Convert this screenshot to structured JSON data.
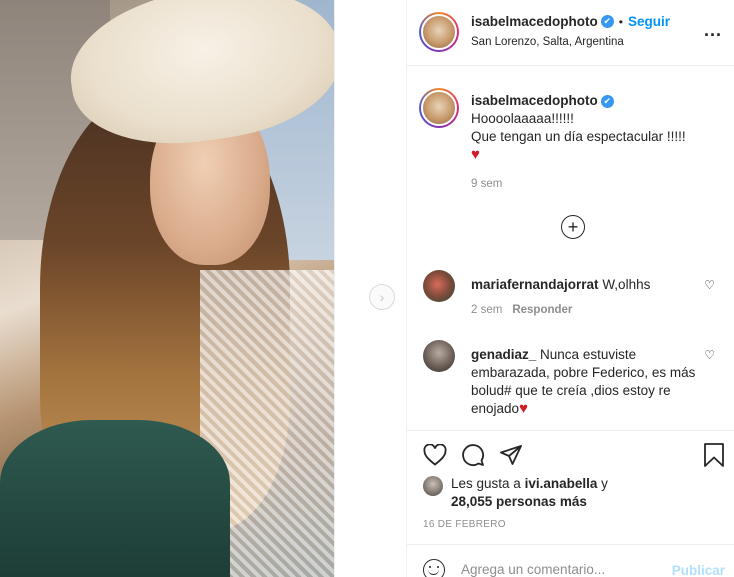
{
  "post": {
    "username": "isabelmacedophoto",
    "verified_glyph": "✔",
    "dot": "•",
    "follow_label": "Seguir",
    "location": "San Lorenzo, Salta, Argentina",
    "more_icon": "...",
    "next_icon": "›",
    "photo_alt": "Selfie photo of woman in straw hat"
  },
  "caption": {
    "username": "isabelmacedophoto",
    "line1": "Hoooolaaaaa!!!!!!",
    "line2": "Que tengan un día espectacular !!!!!",
    "emoji": "♥",
    "time": "9 sem"
  },
  "load_more_icon": "+",
  "comments": [
    {
      "username": "mariafernandajorrat",
      "text": "W,olhhs",
      "time": "2 sem",
      "reply_label": "Responder",
      "like_icon": "♡"
    },
    {
      "username": "genadiaz_",
      "text": "Nunca estuviste embarazada, pobre Federico, es más bolud# que te creía ,dios estoy re enojado",
      "emoji": "♥",
      "like_icon": "♡"
    }
  ],
  "likes": {
    "prefix": "Les gusta a",
    "user": "ivi.anabella",
    "connector": "y",
    "count": "28,055 personas más"
  },
  "date": "16 DE FEBRERO",
  "comment_box": {
    "placeholder": "Agrega un comentario...",
    "publish_label": "Publicar"
  },
  "colors": {
    "link_blue": "#0095f6",
    "publish_disabled": "#b2dffc",
    "verified_blue": "#3897f0",
    "muted_gray": "#8e8e8e"
  }
}
